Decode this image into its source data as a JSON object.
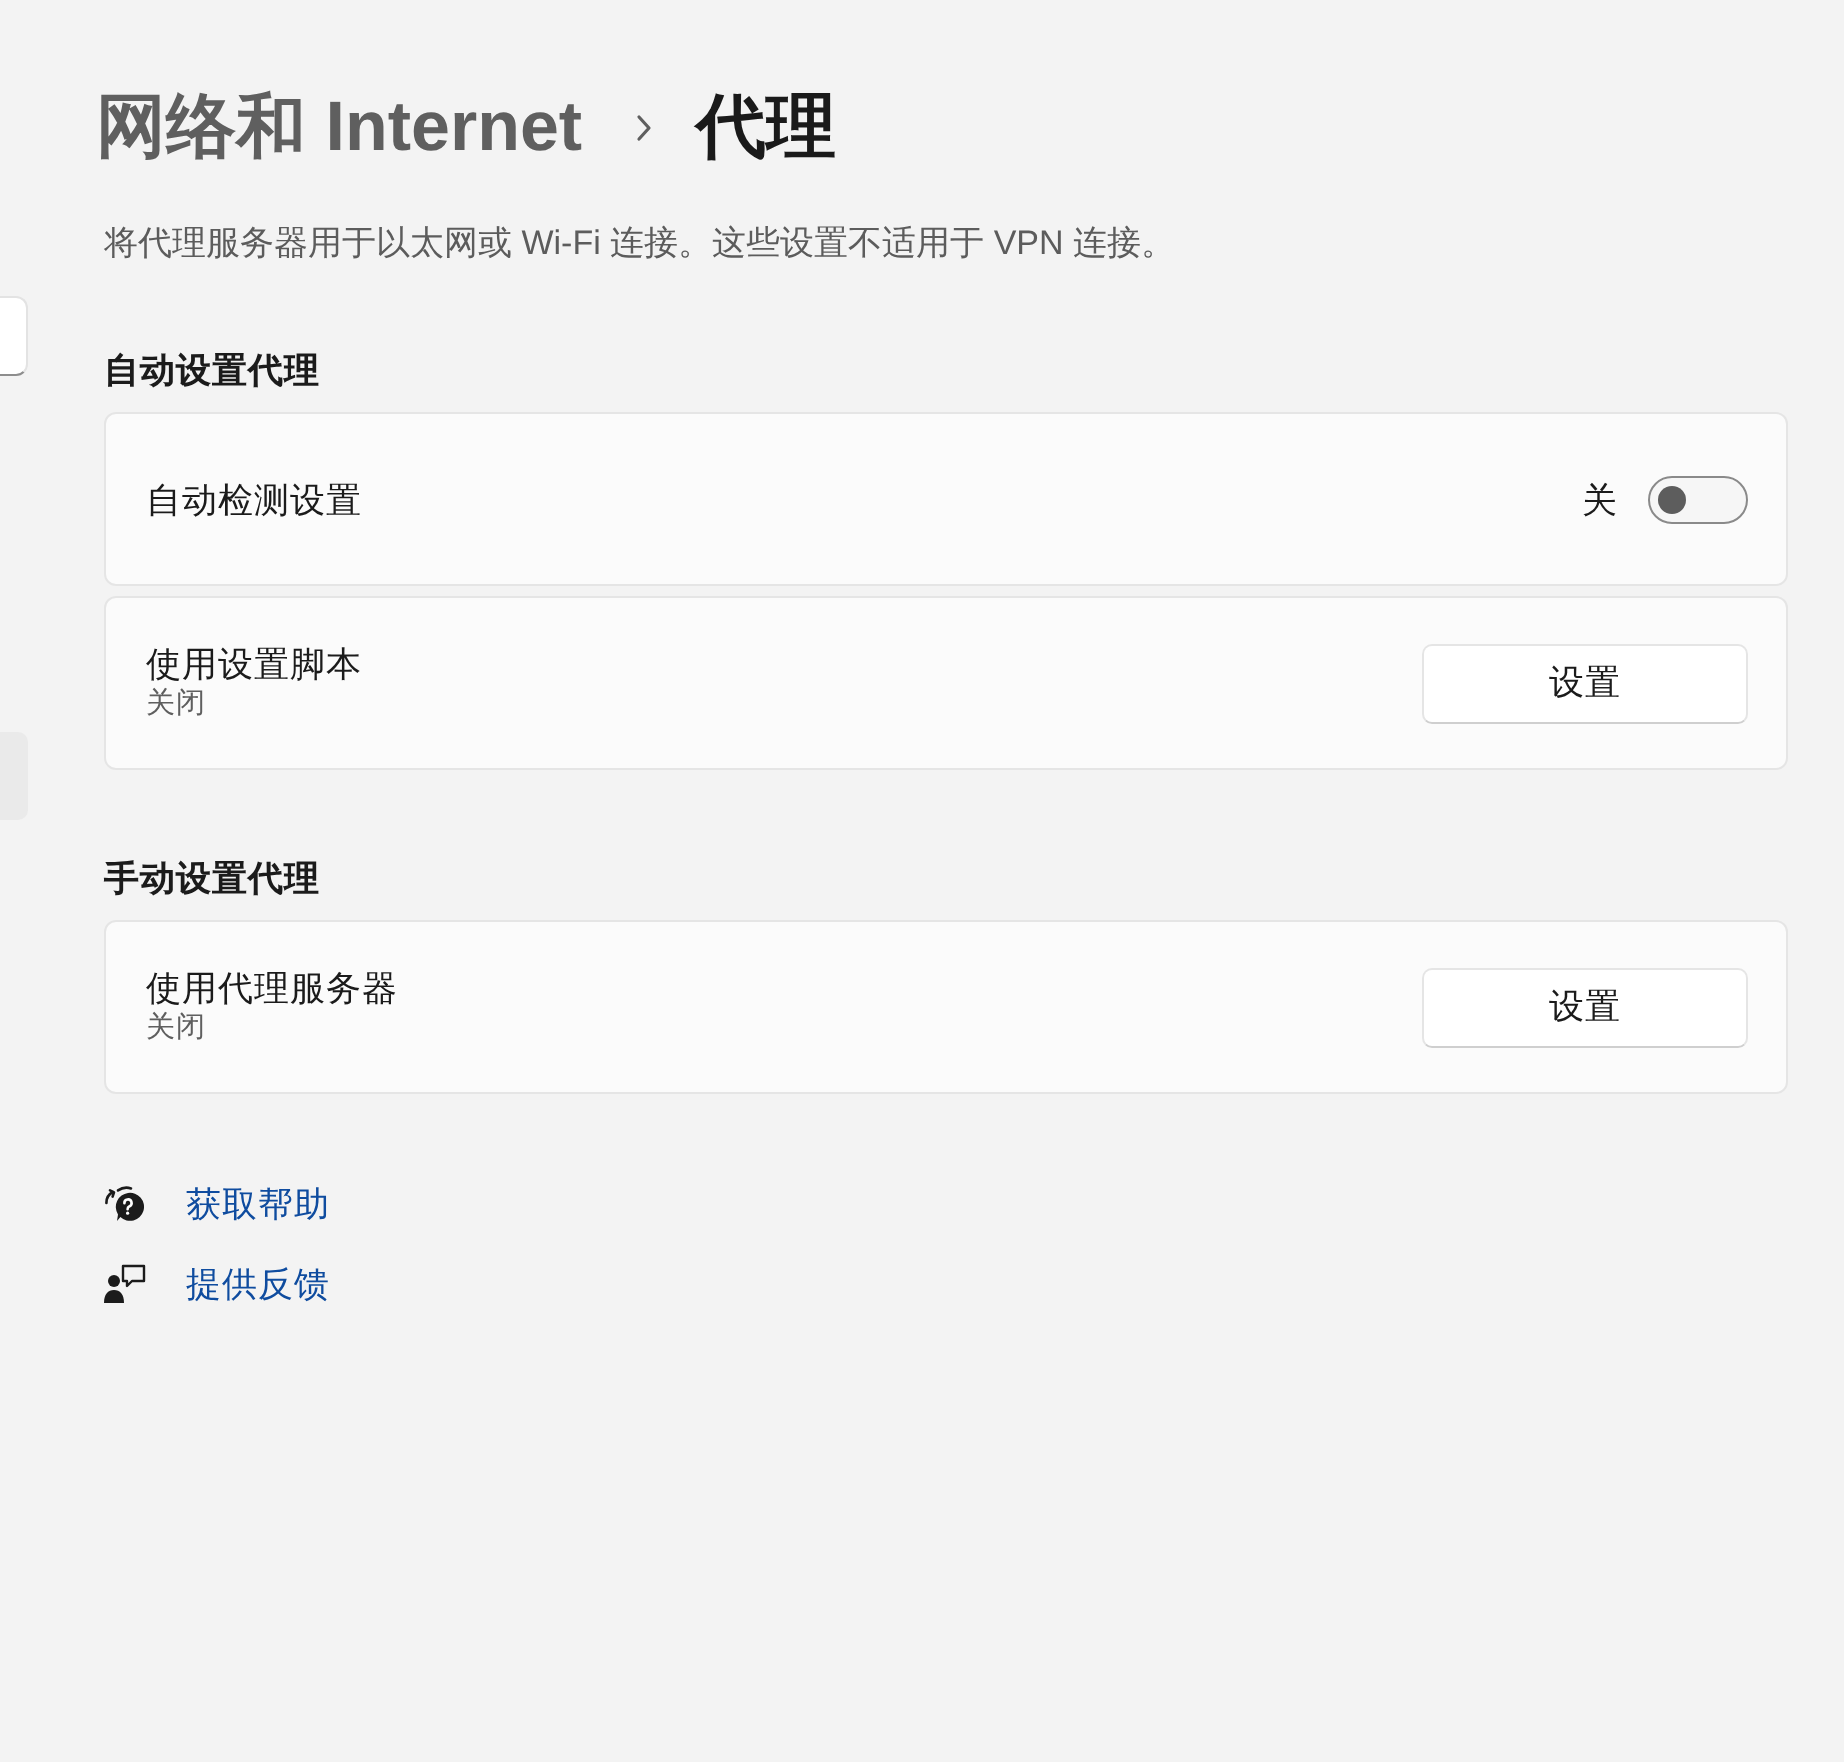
{
  "breadcrumb": {
    "parent": "网络和 Internet",
    "current": "代理"
  },
  "description": "将代理服务器用于以太网或 Wi-Fi 连接。这些设置不适用于 VPN 连接。",
  "sections": [
    {
      "heading": "自动设置代理",
      "cards": [
        {
          "kind": "toggle",
          "title": "自动检测设置",
          "toggle": {
            "on": false,
            "state_label": "关"
          }
        },
        {
          "kind": "button",
          "title": "使用设置脚本",
          "subtitle": "关闭",
          "button": "设置"
        }
      ]
    },
    {
      "heading": "手动设置代理",
      "cards": [
        {
          "kind": "button",
          "title": "使用代理服务器",
          "subtitle": "关闭",
          "button": "设置"
        }
      ]
    }
  ],
  "links": [
    {
      "kind": "help",
      "label": "获取帮助"
    },
    {
      "kind": "feedback",
      "label": "提供反馈"
    }
  ]
}
